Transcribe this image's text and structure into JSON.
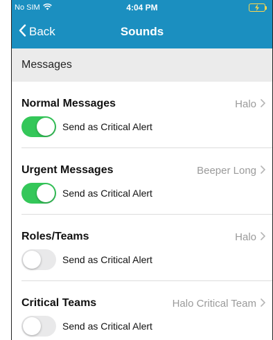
{
  "status_bar": {
    "carrier": "No SIM",
    "wifi_icon": "wifi-icon",
    "time": "4:04 PM",
    "battery_icon": "charging-battery-icon"
  },
  "nav": {
    "back_label": "Back",
    "title": "Sounds"
  },
  "section": {
    "header": "Messages"
  },
  "rows": [
    {
      "title": "Normal Messages",
      "value": "Halo",
      "toggle_label": "Send as Critical Alert",
      "toggle_on": true
    },
    {
      "title": "Urgent Messages",
      "value": "Beeper Long",
      "toggle_label": "Send as Critical Alert",
      "toggle_on": true
    },
    {
      "title": "Roles/Teams",
      "value": "Halo",
      "toggle_label": "Send as Critical Alert",
      "toggle_on": false
    },
    {
      "title": "Critical Teams",
      "value": "Halo Critical Team",
      "toggle_label": "Send as Critical Alert",
      "toggle_on": false
    }
  ],
  "colors": {
    "header_blue": "#1b8fc0",
    "toggle_on": "#34c759",
    "toggle_off": "#e9e9ea",
    "section_bg": "#ebebeb"
  }
}
